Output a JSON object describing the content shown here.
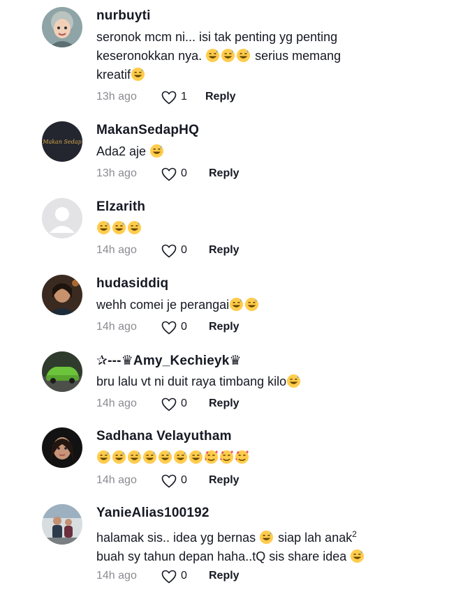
{
  "colors": {
    "text": "#161823",
    "meta": "#8a8b91",
    "emoji_face": "#FFCC4D",
    "emoji_accent": "#E8596E"
  },
  "comments": [
    {
      "username": "nurbuyti",
      "text_parts": [
        "seronok mcm ni... isi tak penting yg penting",
        "keseronokkan nya. ",
        "serius memang",
        "kreatif"
      ],
      "time": "13h ago",
      "likes": "1",
      "reply": "Reply"
    },
    {
      "username": "MakanSedapHQ",
      "text_parts": [
        "Ada2 aje "
      ],
      "time": "13h ago",
      "likes": "0",
      "reply": "Reply",
      "avatar_text": "Makan Sedap"
    },
    {
      "username": "Elzarith",
      "text_parts": [],
      "time": "14h ago",
      "likes": "0",
      "reply": "Reply"
    },
    {
      "username": "hudasiddiq",
      "text_parts": [
        "wehh comei je perangai"
      ],
      "time": "14h ago",
      "likes": "0",
      "reply": "Reply"
    },
    {
      "username": "✰---♛Amy_Kechieyk♛",
      "text_parts": [
        "bru lalu vt ni duit raya timbang kilo"
      ],
      "time": "14h ago",
      "likes": "0",
      "reply": "Reply"
    },
    {
      "username": "Sadhana Velayutham",
      "text_parts": [],
      "time": "14h ago",
      "likes": "0",
      "reply": "Reply"
    },
    {
      "username": "YanieAlias100192",
      "text_parts": [
        "halamak sis.. idea yg bernas ",
        "siap lah anak",
        "2",
        "buah sy tahun depan haha..tQ sis share idea "
      ],
      "time": "14h ago",
      "likes": "0",
      "reply": "Reply"
    }
  ]
}
